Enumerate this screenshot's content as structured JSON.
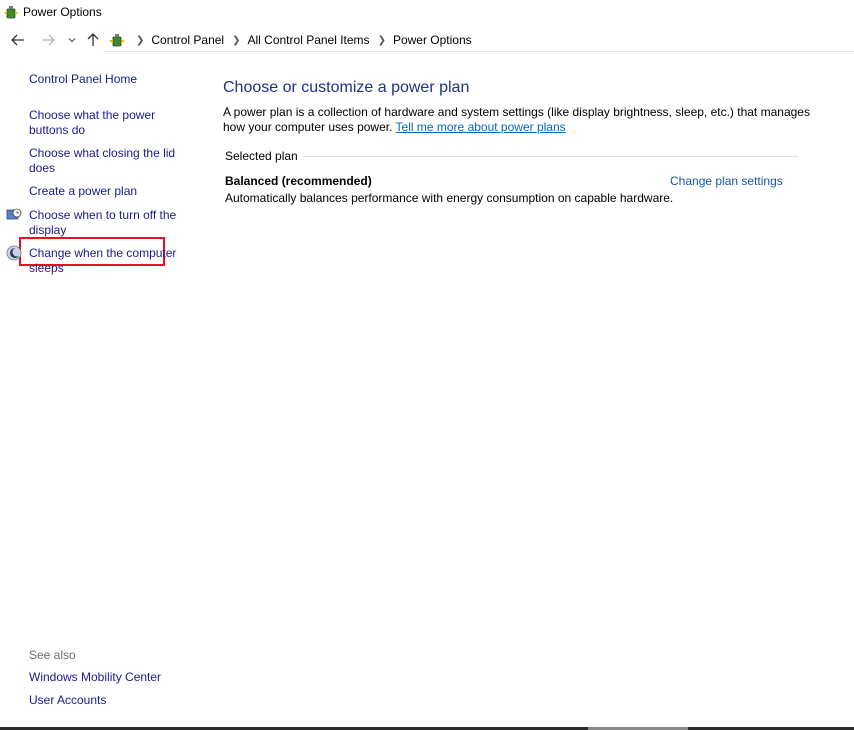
{
  "window": {
    "title": "Power Options"
  },
  "nav": {
    "back_icon": "arrow-left-icon",
    "forward_icon": "arrow-right-icon",
    "recent_icon": "chevron-down-icon",
    "up_icon": "arrow-up-icon"
  },
  "breadcrumb": {
    "items": [
      "Control Panel",
      "All Control Panel Items",
      "Power Options"
    ]
  },
  "sidebar": {
    "home": "Control Panel Home",
    "links": [
      "Choose what the power buttons do",
      "Choose what closing the lid does",
      "Create a power plan",
      "Choose when to turn off the display",
      "Change when the computer sleeps"
    ],
    "see_also_label": "See also",
    "see_also": [
      "Windows Mobility Center",
      "User Accounts"
    ]
  },
  "main": {
    "title": "Choose or customize a power plan",
    "description": "A power plan is a collection of hardware and system settings (like display brightness, sleep, etc.) that manages how your computer uses power.",
    "learn_more": "Tell me more about power plans",
    "group_label": "Selected plan",
    "plan_name": "Balanced (recommended)",
    "plan_description": "Automatically balances performance with energy consumption on capable hardware.",
    "plan_settings_link": "Change plan settings"
  },
  "colors": {
    "link": "#1a1a8c",
    "title": "#1e3287",
    "highlight": "#e81123"
  }
}
